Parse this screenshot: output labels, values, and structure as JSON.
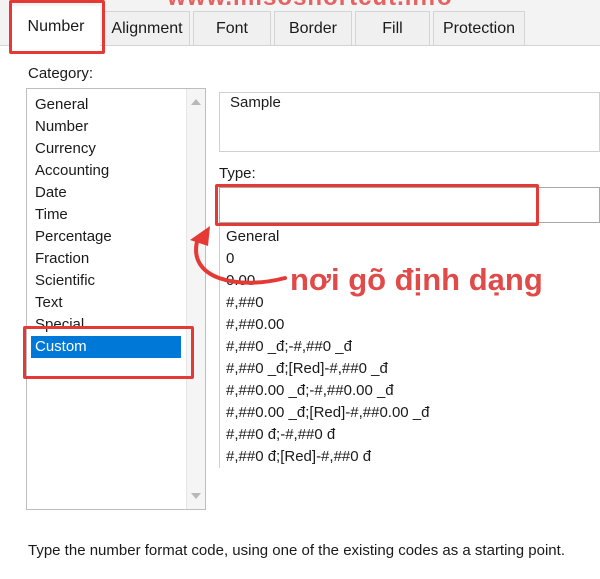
{
  "watermark": "www.misoshortcut.info",
  "tabs": [
    {
      "label": "Number",
      "active": true
    },
    {
      "label": "Alignment",
      "active": false
    },
    {
      "label": "Font",
      "active": false
    },
    {
      "label": "Border",
      "active": false
    },
    {
      "label": "Fill",
      "active": false
    },
    {
      "label": "Protection",
      "active": false
    }
  ],
  "category": {
    "label": "Category:",
    "items": [
      "General",
      "Number",
      "Currency",
      "Accounting",
      "Date",
      "Time",
      "Percentage",
      "Fraction",
      "Scientific",
      "Text",
      "Special",
      "Custom"
    ],
    "selected": "Custom"
  },
  "sample": {
    "label": "Sample",
    "value": ""
  },
  "type": {
    "label": "Type:",
    "value": ""
  },
  "format_codes": [
    "General",
    "0",
    "0.00",
    "#,##0",
    "#,##0.00",
    "#,##0 _đ;-#,##0 _đ",
    "#,##0 _đ;[Red]-#,##0 _đ",
    "#,##0.00 _đ;-#,##0.00 _đ",
    "#,##0.00 _đ;[Red]-#,##0.00 _đ",
    "#,##0 đ;-#,##0 đ",
    "#,##0 đ;[Red]-#,##0 đ"
  ],
  "annotation": "nơi gõ định dạng",
  "footer": "Type the number format code, using one of the existing codes as a starting point.",
  "colors": {
    "highlight": "#e53935",
    "selection": "#0078d7",
    "annotation": "#e04a48"
  },
  "icons": [
    "curved-arrow-icon",
    "scroll-up-icon",
    "scroll-down-icon"
  ]
}
